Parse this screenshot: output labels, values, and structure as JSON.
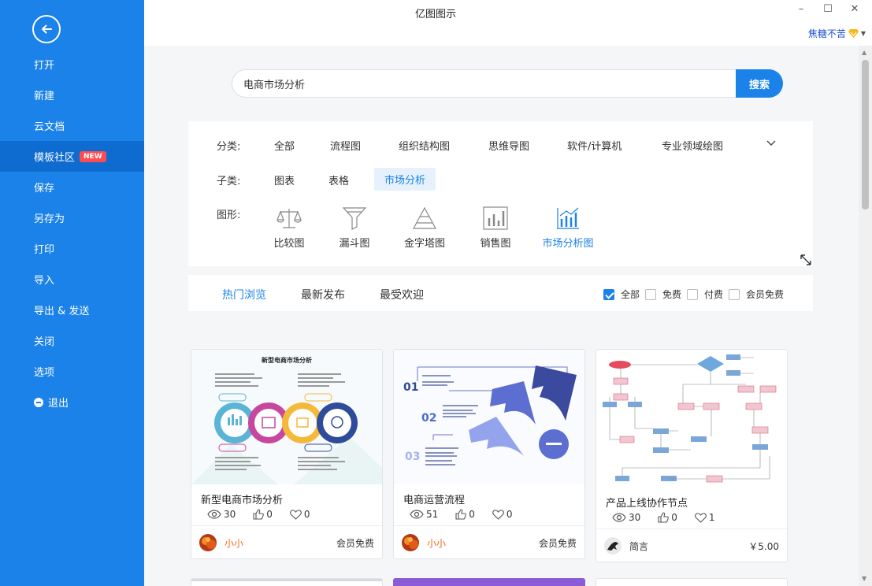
{
  "app": {
    "title": "亿图图示"
  },
  "window": {
    "minimize": "–",
    "maximize": "☐",
    "close": "✕"
  },
  "user": {
    "name": "焦糖不苦"
  },
  "sidebar": {
    "items": [
      {
        "label": "打开"
      },
      {
        "label": "新建"
      },
      {
        "label": "云文档"
      },
      {
        "label": "模板社区",
        "badge": "NEW",
        "active": true
      },
      {
        "label": "保存"
      },
      {
        "label": "另存为"
      },
      {
        "label": "打印"
      },
      {
        "label": "导入"
      },
      {
        "label": "导出 & 发送"
      },
      {
        "label": "关闭"
      },
      {
        "label": "选项"
      },
      {
        "label": "退出"
      }
    ]
  },
  "search": {
    "value": "电商市场分析",
    "button": "搜索"
  },
  "filters": {
    "category_label": "分类:",
    "categories": [
      "全部",
      "流程图",
      "组织结构图",
      "思维导图",
      "软件/计算机",
      "专业领域绘图"
    ],
    "subcategory_label": "子类:",
    "subcategories": [
      "图表",
      "表格",
      "市场分析"
    ],
    "shape_label": "图形:",
    "shapes": [
      "比较图",
      "漏斗图",
      "金字塔图",
      "销售图",
      "市场分析图"
    ]
  },
  "tabs": [
    "热门浏览",
    "最新发布",
    "最受欢迎"
  ],
  "price_filters": [
    "全部",
    "免费",
    "付费",
    "会员免费"
  ],
  "accent": "#1a82e8",
  "cards": [
    {
      "title": "新型电商市场分析",
      "thumb_title": "新型电商市场分析",
      "views": "30",
      "likes": "0",
      "favs": "0",
      "author": "小小",
      "price": "会员免费"
    },
    {
      "title": "电商运营流程",
      "views": "51",
      "likes": "0",
      "favs": "0",
      "author": "小小",
      "price": "会员免费"
    },
    {
      "title": "产品上线协作节点",
      "views": "30",
      "likes": "0",
      "favs": "1",
      "author": "简言",
      "price": "￥5.00"
    }
  ]
}
